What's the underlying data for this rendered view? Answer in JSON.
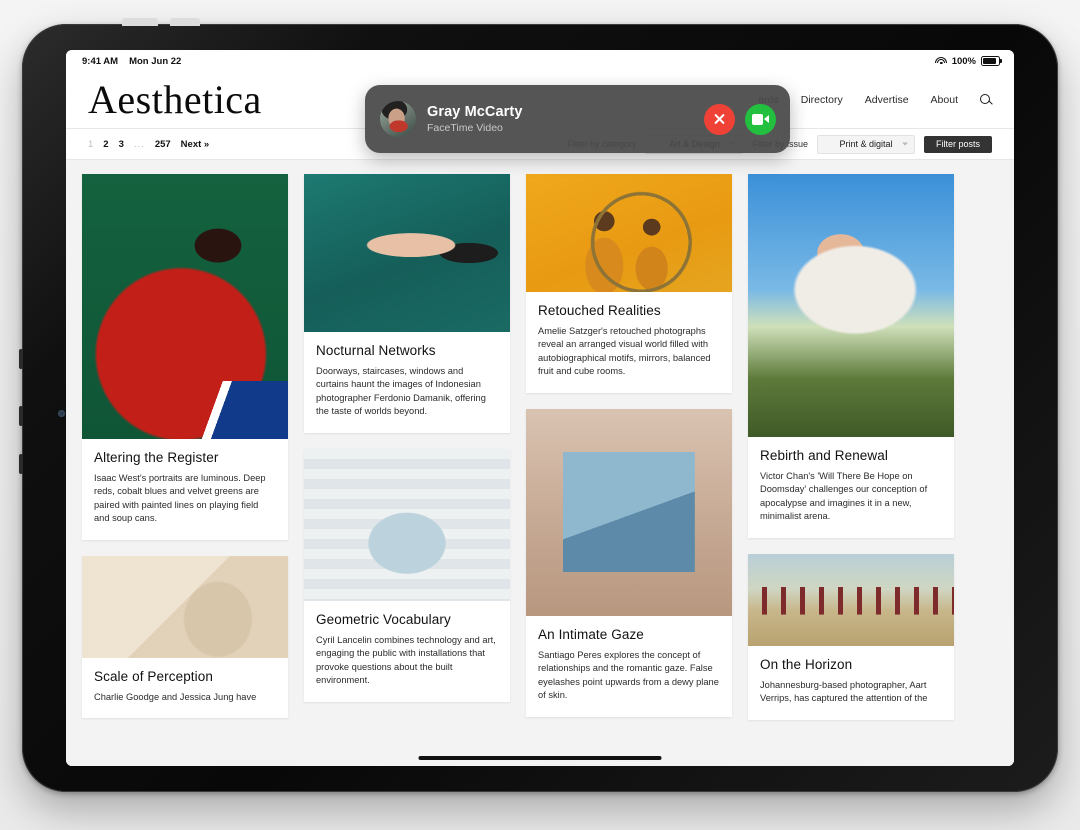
{
  "status_bar": {
    "time": "9:41 AM",
    "date": "Mon Jun 22",
    "battery_percent": "100%",
    "wifi_icon": "wifi-icon",
    "battery_icon": "battery-icon"
  },
  "site": {
    "logo": "Aesthetica",
    "nav": [
      {
        "label": "ards"
      },
      {
        "label": "Directory"
      },
      {
        "label": "Advertise"
      },
      {
        "label": "About"
      }
    ],
    "search_icon": "search-icon"
  },
  "toolbar": {
    "pagination": {
      "pages": [
        "1",
        "2",
        "3"
      ],
      "ellipsis": "...",
      "last_page": "257",
      "next_label": "Next »",
      "current_page": "1"
    },
    "filter_category_label": "Filter by category",
    "filter_category_value": "Art & Design",
    "filter_issue_label": "Filter by issue",
    "filter_issue_value": "Print & digital",
    "filter_button": "Filter posts"
  },
  "articles": {
    "column1": [
      {
        "title": "Altering the Register",
        "excerpt": "Isaac West's portraits are luminous. Deep reds, cobalt blues and velvet greens are paired with painted lines on playing field and soup cans.",
        "image": "red-garment-figure-on-green"
      },
      {
        "title": "Scale of Perception",
        "excerpt": "Charlie Goodge and Jessica Jung have",
        "image": "beige-stairs-and-pedestal"
      }
    ],
    "column2": [
      {
        "title": "Nocturnal Networks",
        "excerpt": "Doorways, staircases, windows and curtains haunt the images of Indonesian photographer Ferdonio Damanik, offering the taste of worlds beyond.",
        "image": "hands-on-teal-curtain"
      },
      {
        "title": "Geometric Vocabulary",
        "excerpt": "Cyril Lancelin combines technology and art, engaging the public with installations that provoke questions about the built environment.",
        "image": "white-foam-installation"
      }
    ],
    "column3": [
      {
        "title": "Retouched Realities",
        "excerpt": "Amelie Satzger's retouched photographs reveal an arranged visual world filled with autobiographical motifs, mirrors, balanced fruit and cube rooms.",
        "image": "two-figures-in-yellow"
      },
      {
        "title": "An Intimate Gaze",
        "excerpt": "Santiago Peres explores the concept of relationships and the romantic gaze. False eyelashes point upwards from a dewy plane of skin.",
        "image": "hands-at-blue-mirror"
      }
    ],
    "column4": [
      {
        "title": "Rebirth and Renewal",
        "excerpt": "Victor Chan's 'Will There Be Hope on Doomsday' challenges our conception of apocalypse and imagines it in a new, minimalist arena.",
        "image": "couple-in-field-under-sky"
      },
      {
        "title": "On the Horizon",
        "excerpt": "Johannesburg-based photographer, Aart Verrips, has captured the attention of the",
        "image": "figures-in-red-on-field"
      }
    ]
  },
  "facetime_banner": {
    "caller_name": "Gray McCarty",
    "call_type": "FaceTime Video",
    "avatar": "caller-avatar",
    "decline_icon": "close-icon",
    "accept_icon": "video-camera-icon",
    "decline_color": "#ef4136",
    "accept_color": "#22c03e",
    "background_color": "#484848"
  }
}
